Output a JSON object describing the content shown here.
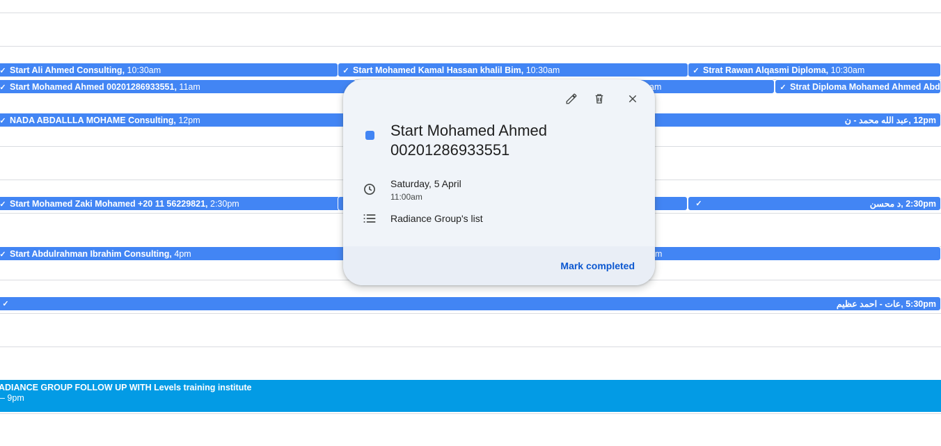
{
  "events": {
    "r1c1": {
      "title": "Start Ali Ahmed Consulting,",
      "time": "10:30am"
    },
    "r1c2": {
      "title": "Start Mohamed Kamal Hassan khalil Bim,",
      "time": "10:30am"
    },
    "r1c3": {
      "title": "Strat Rawan Alqasmi Diploma,",
      "time": "10:30am"
    },
    "r2c1": {
      "title": "Start Mohamed Ahmed 00201286933551,",
      "time": "11am"
    },
    "r2c2": {
      "title": "am"
    },
    "r2c3": {
      "title": "Strat Diploma Mohamed Ahmed Abde"
    },
    "r3c1": {
      "title": "NADA ABDALLLA MOHAME Consulting,",
      "time": "12pm"
    },
    "r3c3": {
      "title": "12pm ,عبد الله محمد - ن"
    },
    "r4c1": {
      "title": "Start Mohamed Zaki Mohamed +20 11 56229821,",
      "time": "2:30pm"
    },
    "r4c3": {
      "title": "2:30pm ,د محسن"
    },
    "r5c1": {
      "title": "Start Abdulrahman Ibrahim Consulting,",
      "time": "4pm"
    },
    "r5c2": {
      "title": "m"
    },
    "r6c3": {
      "title": "5:30pm ,عات - احمد عظيم"
    },
    "big": {
      "title": "ADIANCE GROUP FOLLOW UP WITH Levels training institute",
      "time": "– 9pm"
    }
  },
  "popup": {
    "title": "Start Mohamed Ahmed 00201286933551",
    "date": "Saturday, 5 April",
    "time": "11:00am",
    "list": "Radiance Group's list",
    "mark_completed": "Mark completed"
  },
  "colors": {
    "event_blue": "#4285f4",
    "event_cyan": "#039be5",
    "accent": "#0b57d0"
  },
  "icons": {
    "edit": "pencil-icon",
    "delete": "trash-icon",
    "close": "close-icon",
    "clock": "clock-icon",
    "list": "list-icon",
    "check": "check-circle-icon"
  }
}
